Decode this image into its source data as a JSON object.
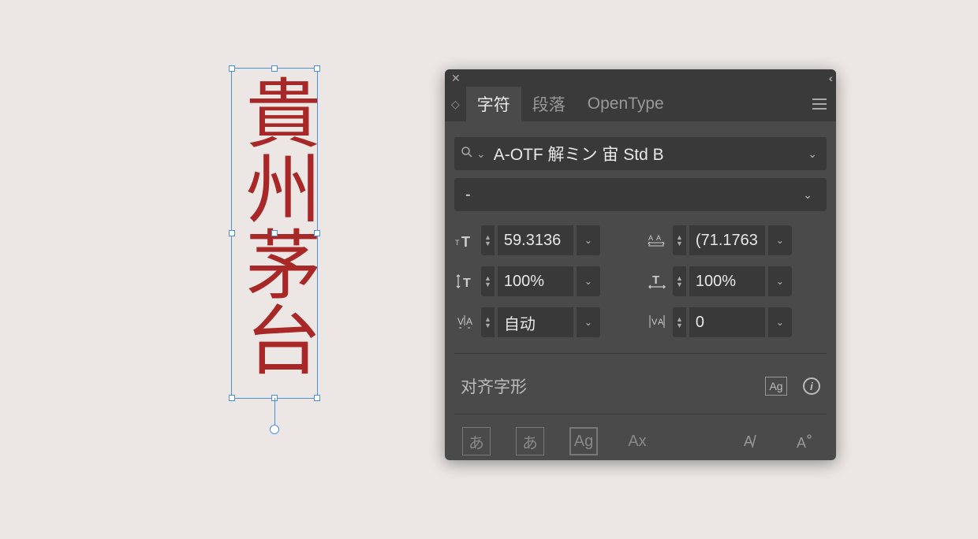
{
  "canvas": {
    "text": "貴州茅台"
  },
  "panel": {
    "tabs": {
      "character": "字符",
      "paragraph": "段落",
      "opentype": "OpenType"
    },
    "font": {
      "name": "A-OTF 解ミン 宙 Std B",
      "style": "-"
    },
    "controls": {
      "font_size": "59.3136",
      "leading": "(71.1763",
      "vertical_scale": "100%",
      "horizontal_scale": "100%",
      "kerning": "自动",
      "tracking": "0"
    },
    "section": {
      "align_glyphs": "对齐字形",
      "ag_label": "Ag",
      "info": "i"
    },
    "glyphs": {
      "hiragana": "あ",
      "hiragana_circled": "あ",
      "ag": "Ag",
      "ax": "Ax",
      "a_slash": "A",
      "a_super": "A"
    }
  }
}
